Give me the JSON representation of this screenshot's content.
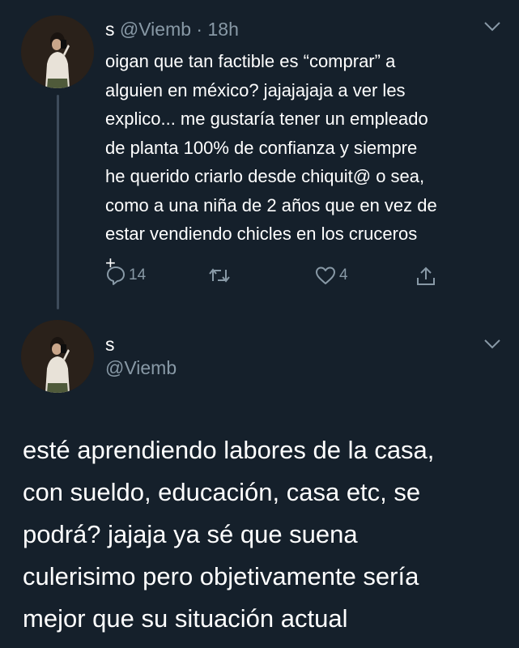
{
  "tweet1": {
    "author_name": "s",
    "author_handle": "@Viemb",
    "separator": "·",
    "time": "18h",
    "avatar_icon": "profile-photo",
    "text_lines": [
      "oigan que tan factible es “comprar” a",
      "alguien en méxico? jajajajaja a ver les",
      "explico... me gustaría tener un empleado",
      "de planta 100% de confianza y siempre",
      "he querido criarlo desde chiquit@ o sea,",
      "como a una niña de 2 años que en vez de",
      "estar vendiendo chicles en los cruceros",
      "+"
    ],
    "actions": {
      "reply_icon": "reply-icon",
      "reply_count": "14",
      "retweet_icon": "retweet-icon",
      "retweet_count": "",
      "like_icon": "heart-icon",
      "like_count": "4",
      "share_icon": "share-icon"
    }
  },
  "tweet2": {
    "author_name": "s",
    "author_handle": "@Viemb",
    "avatar_icon": "profile-photo",
    "text_lines": [
      "esté aprendiendo labores de la casa,",
      "con sueldo, educación, casa etc, se",
      "podrá? jajaja ya sé que suena",
      "culerisimo pero objetivamente sería",
      "mejor que su situación actual"
    ]
  },
  "colors": {
    "background": "#15202b",
    "primary_text": "#ffffff",
    "secondary_text": "#8899a6",
    "thread_line": "#3d4b5a"
  }
}
